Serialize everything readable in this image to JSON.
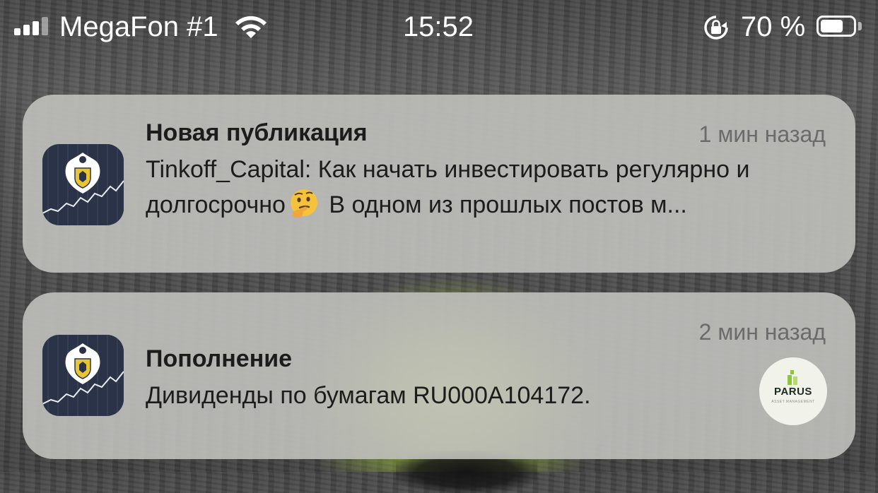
{
  "status_bar": {
    "carrier": "MegaFon #1",
    "time": "15:52",
    "battery_percent": "70 %",
    "battery_level": 0.7,
    "signal_bars": 3,
    "icons": [
      "signal-icon",
      "wifi-icon",
      "rotation-lock-icon",
      "battery-icon"
    ]
  },
  "notifications": [
    {
      "app_icon": "tinkoff-app-icon",
      "title": "Новая публикация",
      "time": "1 мин назад",
      "body_part1": "Tinkoff_Capital: Как начать инвестировать регулярно и долгосрочно",
      "emoji": "thinking-face-emoji",
      "body_part2": " В одном из прошлых постов м..."
    },
    {
      "app_icon": "tinkoff-app-icon",
      "title": "Пополнение",
      "time": "2 мин назад",
      "body": "Дивиденды по бумагам RU000A104172.",
      "thumbnail": {
        "name": "PARUS",
        "subtitle": "ASSET MANAGEMENT",
        "background": "#f1f3ea",
        "accent": "#8cc63f"
      }
    }
  ],
  "colors": {
    "notification_bg": "#c0c0bc",
    "title_text": "#1c1c1c",
    "time_text": "#6b6b6b",
    "icon_bg": "#2a3347",
    "icon_shield": "#e8c531"
  }
}
